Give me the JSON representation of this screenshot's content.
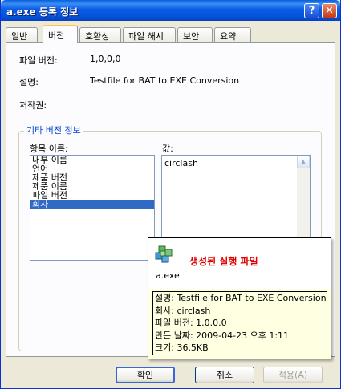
{
  "window": {
    "title": "a.exe 등록 정보",
    "help_label": "?",
    "close_label": "✕"
  },
  "tabs": [
    {
      "label": "일반",
      "active": false
    },
    {
      "label": "버전",
      "active": true
    },
    {
      "label": "호환성",
      "active": false
    },
    {
      "label": "파일 해시",
      "active": false
    },
    {
      "label": "보안",
      "active": false
    },
    {
      "label": "요약",
      "active": false
    }
  ],
  "version": {
    "file_version_label": "파일 버전:",
    "file_version_value": "1,0,0,0",
    "description_label": "설명:",
    "description_value": "Testfile for BAT to EXE Conversion",
    "copyright_label": "저작권:"
  },
  "other_info": {
    "group_title": "기타 버전 정보",
    "item_name_label": "항목 이름:",
    "value_label": "값:",
    "items": [
      "내부 이름",
      "언어",
      "제품 버전",
      "제품 이름",
      "파일 버전",
      "회사"
    ],
    "selected_index": 5,
    "selected_value": "circlash"
  },
  "tooltip": {
    "title": "생성된 실행 파일",
    "file_name": "a.exe",
    "lines": [
      "설명: Testfile for BAT to EXE Conversion",
      "회사: circlash",
      "파일 버전: 1.0.0.0",
      "만든 날짜: 2009-04-23 오후 1:11",
      "크기: 36.5KB"
    ]
  },
  "buttons": {
    "ok": "확인",
    "cancel": "취소",
    "apply": "적용(A)"
  }
}
